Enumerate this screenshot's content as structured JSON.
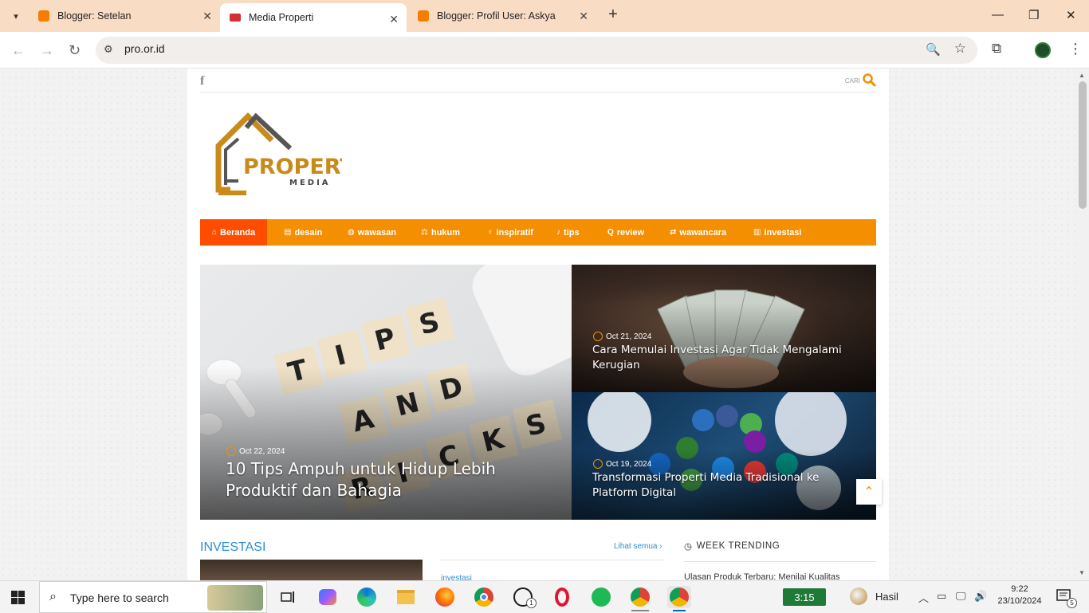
{
  "browser": {
    "tabs": [
      {
        "title": "Blogger: Setelan",
        "icon": "blogger-icon"
      },
      {
        "title": "Media Properti",
        "icon": "site-favicon",
        "active": true
      },
      {
        "title": "Blogger: Profil User: Askya",
        "icon": "blogger-icon"
      }
    ],
    "url": "pro.or.id"
  },
  "site": {
    "social": "f",
    "search_label": "CARI",
    "logo": {
      "word1": "PROPERTI",
      "word2": "MEDIA"
    },
    "nav": [
      {
        "label": "Beranda",
        "icon": "home-icon",
        "active": true
      },
      {
        "label": "desain",
        "icon": "newspaper-icon"
      },
      {
        "label": "wawasan",
        "icon": "globe-icon"
      },
      {
        "label": "hukum",
        "icon": "balance-icon"
      },
      {
        "label": "inspiratif",
        "icon": "lightbulb-icon"
      },
      {
        "label": "tips",
        "icon": "bell-icon"
      },
      {
        "label": "review",
        "icon": "search-icon"
      },
      {
        "label": "wawancara",
        "icon": "handshake-icon"
      },
      {
        "label": "investasi",
        "icon": "chart-icon"
      }
    ],
    "featured": [
      {
        "date": "Oct 22, 2024",
        "title": "10 Tips Ampuh untuk Hidup Lebih Produktif dan Bahagia",
        "image": "tips-and-tricks-tiles"
      },
      {
        "date": "Oct 21, 2024",
        "title": "Cara Memulai Investasi Agar Tidak Mengalami Kerugian",
        "image": "money-in-hands"
      },
      {
        "date": "Oct 19, 2024",
        "title": "Transformasi Properti Media Tradisional ke Platform Digital",
        "image": "social-media-icons"
      }
    ],
    "section_title": "INVESTASI",
    "see_all": "Lihat semua",
    "category_label": "investasi",
    "trending_title": "WEEK TRENDING",
    "trending_first": "Ulasan Produk Terbaru: Menilai Kualitas"
  },
  "taskbar": {
    "search_placeholder": "Type here to search",
    "battery": "3:15",
    "weather": "Hasil",
    "time": "9:22",
    "date": "23/10/2024",
    "notifications": "5",
    "whatsapp_badge": "1"
  },
  "colors": {
    "accent": "#f38f00",
    "active_nav": "#ff4d00",
    "link": "#2b8fd6",
    "brand_gold": "#c98a1c",
    "brand_gray": "#555555"
  }
}
